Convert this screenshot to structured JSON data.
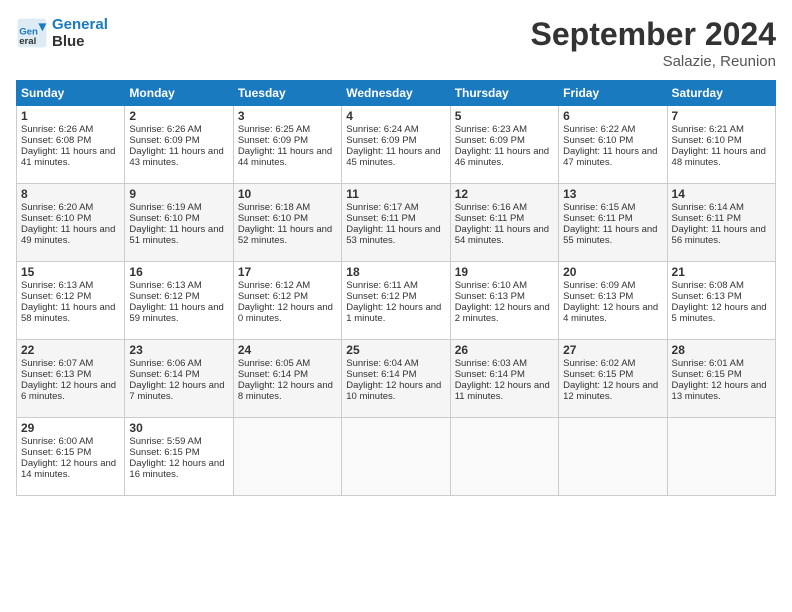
{
  "logo": {
    "line1": "General",
    "line2": "Blue"
  },
  "title": "September 2024",
  "location": "Salazie, Reunion",
  "days_header": [
    "Sunday",
    "Monday",
    "Tuesday",
    "Wednesday",
    "Thursday",
    "Friday",
    "Saturday"
  ],
  "weeks": [
    [
      {
        "day": "1",
        "sunrise": "6:26 AM",
        "sunset": "6:08 PM",
        "daylight": "11 hours and 41 minutes."
      },
      {
        "day": "2",
        "sunrise": "6:26 AM",
        "sunset": "6:09 PM",
        "daylight": "11 hours and 43 minutes."
      },
      {
        "day": "3",
        "sunrise": "6:25 AM",
        "sunset": "6:09 PM",
        "daylight": "11 hours and 44 minutes."
      },
      {
        "day": "4",
        "sunrise": "6:24 AM",
        "sunset": "6:09 PM",
        "daylight": "11 hours and 45 minutes."
      },
      {
        "day": "5",
        "sunrise": "6:23 AM",
        "sunset": "6:09 PM",
        "daylight": "11 hours and 46 minutes."
      },
      {
        "day": "6",
        "sunrise": "6:22 AM",
        "sunset": "6:10 PM",
        "daylight": "11 hours and 47 minutes."
      },
      {
        "day": "7",
        "sunrise": "6:21 AM",
        "sunset": "6:10 PM",
        "daylight": "11 hours and 48 minutes."
      }
    ],
    [
      {
        "day": "8",
        "sunrise": "6:20 AM",
        "sunset": "6:10 PM",
        "daylight": "11 hours and 49 minutes."
      },
      {
        "day": "9",
        "sunrise": "6:19 AM",
        "sunset": "6:10 PM",
        "daylight": "11 hours and 51 minutes."
      },
      {
        "day": "10",
        "sunrise": "6:18 AM",
        "sunset": "6:10 PM",
        "daylight": "11 hours and 52 minutes."
      },
      {
        "day": "11",
        "sunrise": "6:17 AM",
        "sunset": "6:11 PM",
        "daylight": "11 hours and 53 minutes."
      },
      {
        "day": "12",
        "sunrise": "6:16 AM",
        "sunset": "6:11 PM",
        "daylight": "11 hours and 54 minutes."
      },
      {
        "day": "13",
        "sunrise": "6:15 AM",
        "sunset": "6:11 PM",
        "daylight": "11 hours and 55 minutes."
      },
      {
        "day": "14",
        "sunrise": "6:14 AM",
        "sunset": "6:11 PM",
        "daylight": "11 hours and 56 minutes."
      }
    ],
    [
      {
        "day": "15",
        "sunrise": "6:13 AM",
        "sunset": "6:12 PM",
        "daylight": "11 hours and 58 minutes."
      },
      {
        "day": "16",
        "sunrise": "6:13 AM",
        "sunset": "6:12 PM",
        "daylight": "11 hours and 59 minutes."
      },
      {
        "day": "17",
        "sunrise": "6:12 AM",
        "sunset": "6:12 PM",
        "daylight": "12 hours and 0 minutes."
      },
      {
        "day": "18",
        "sunrise": "6:11 AM",
        "sunset": "6:12 PM",
        "daylight": "12 hours and 1 minute."
      },
      {
        "day": "19",
        "sunrise": "6:10 AM",
        "sunset": "6:13 PM",
        "daylight": "12 hours and 2 minutes."
      },
      {
        "day": "20",
        "sunrise": "6:09 AM",
        "sunset": "6:13 PM",
        "daylight": "12 hours and 4 minutes."
      },
      {
        "day": "21",
        "sunrise": "6:08 AM",
        "sunset": "6:13 PM",
        "daylight": "12 hours and 5 minutes."
      }
    ],
    [
      {
        "day": "22",
        "sunrise": "6:07 AM",
        "sunset": "6:13 PM",
        "daylight": "12 hours and 6 minutes."
      },
      {
        "day": "23",
        "sunrise": "6:06 AM",
        "sunset": "6:14 PM",
        "daylight": "12 hours and 7 minutes."
      },
      {
        "day": "24",
        "sunrise": "6:05 AM",
        "sunset": "6:14 PM",
        "daylight": "12 hours and 8 minutes."
      },
      {
        "day": "25",
        "sunrise": "6:04 AM",
        "sunset": "6:14 PM",
        "daylight": "12 hours and 10 minutes."
      },
      {
        "day": "26",
        "sunrise": "6:03 AM",
        "sunset": "6:14 PM",
        "daylight": "12 hours and 11 minutes."
      },
      {
        "day": "27",
        "sunrise": "6:02 AM",
        "sunset": "6:15 PM",
        "daylight": "12 hours and 12 minutes."
      },
      {
        "day": "28",
        "sunrise": "6:01 AM",
        "sunset": "6:15 PM",
        "daylight": "12 hours and 13 minutes."
      }
    ],
    [
      {
        "day": "29",
        "sunrise": "6:00 AM",
        "sunset": "6:15 PM",
        "daylight": "12 hours and 14 minutes."
      },
      {
        "day": "30",
        "sunrise": "5:59 AM",
        "sunset": "6:15 PM",
        "daylight": "12 hours and 16 minutes."
      },
      null,
      null,
      null,
      null,
      null
    ]
  ]
}
